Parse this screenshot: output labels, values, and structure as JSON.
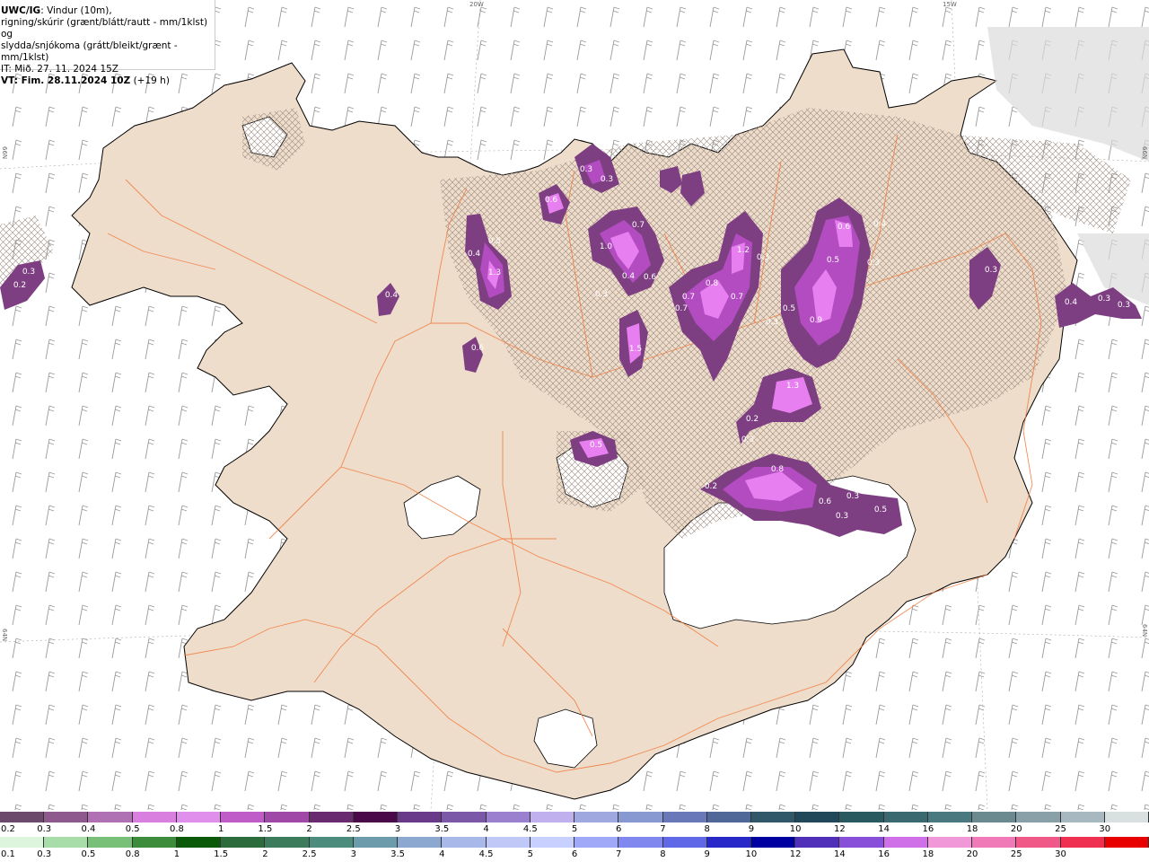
{
  "info": {
    "line1_bold": "UWC/IG",
    "line1_rest": ": Vindur (10m),",
    "line2": "rigning/skúrir (grænt/blátt/rautt - mm/1klst) og",
    "line3": "slydda/snjókoma (grátt/bleikt/grænt - mm/1klst)",
    "line4": "IT: Mið. 27. 11. 2024 15Z",
    "line5_bold": "VT: Fim. 28.11.2024 10Z",
    "line5_rest": " (+19 h)"
  },
  "coords": {
    "top_20w": "20W",
    "top_15w": "15W",
    "left_66n": "66N",
    "right_66n": "66N",
    "left_64n": "64N",
    "right_64n": "64N"
  },
  "colors": {
    "sea": "#ffffff",
    "land": "#efddcb",
    "roads": "#f07a3c",
    "precip_dark": "#7e3f82",
    "precip_mid": "#b24cc0",
    "precip_light": "#e87ff0"
  },
  "precip_labels": [
    {
      "text": "0.3"
    },
    {
      "text": "0.2"
    },
    {
      "text": "0.6"
    },
    {
      "text": "0.3"
    },
    {
      "text": "0.3"
    },
    {
      "text": "0.5"
    },
    {
      "text": "0.4"
    },
    {
      "text": "1.3"
    },
    {
      "text": "1.0"
    },
    {
      "text": "0.7"
    },
    {
      "text": "0.4"
    },
    {
      "text": "0.6"
    },
    {
      "text": "0.3"
    },
    {
      "text": "1.5"
    },
    {
      "text": "0.7"
    },
    {
      "text": "0.8"
    },
    {
      "text": "0.7"
    },
    {
      "text": "0.7"
    },
    {
      "text": "1.2"
    },
    {
      "text": "0.3"
    },
    {
      "text": "0.6"
    },
    {
      "text": "0.4"
    },
    {
      "text": "0.5"
    },
    {
      "text": "0.3"
    },
    {
      "text": "0.5"
    },
    {
      "text": "0.9"
    },
    {
      "text": "0.3"
    },
    {
      "text": "1.3"
    },
    {
      "text": "0.2"
    },
    {
      "text": "0.3"
    },
    {
      "text": "0.5"
    },
    {
      "text": "0.8"
    },
    {
      "text": "0.2"
    },
    {
      "text": "0.6"
    },
    {
      "text": "0.3"
    },
    {
      "text": "0.3"
    },
    {
      "text": "0.5"
    },
    {
      "text": "0.4"
    },
    {
      "text": "0.3"
    },
    {
      "text": "0.3"
    },
    {
      "text": "0.4"
    },
    {
      "text": "0.6"
    },
    {
      "text": "0.3"
    }
  ],
  "legend": {
    "row1_labels": [
      "0.2",
      "0.3",
      "0.4",
      "0.5",
      "0.8",
      "1",
      "1.5",
      "2",
      "2.5",
      "3",
      "3.5",
      "4",
      "4.5",
      "5",
      "6",
      "7",
      "8",
      "9",
      "10",
      "12",
      "14",
      "16",
      "18",
      "20",
      "25",
      "30"
    ],
    "row1_colors": [
      "#6b4a6b",
      "#8e5a8e",
      "#b070b4",
      "#d87fe0",
      "#e090ec",
      "#c05cc8",
      "#a048a8",
      "#6a2a70",
      "#4a0a4a",
      "#6a3a8a",
      "#7c58a8",
      "#9c80d0",
      "#c0b0ee",
      "#a0a8e0",
      "#8898d0",
      "#6878b8",
      "#506898",
      "#305868",
      "#204858",
      "#285a60",
      "#3a6a70",
      "#4a7a80",
      "#6a8a90",
      "#8aa0a8",
      "#a8b8c0",
      "#d8e0e0"
    ],
    "row2_labels": [
      "0.1",
      "0.3",
      "0.5",
      "0.8",
      "1",
      "1.5",
      "2",
      "2.5",
      "3",
      "3.5",
      "4",
      "4.5",
      "5",
      "6",
      "7",
      "8",
      "9",
      "10",
      "12",
      "14",
      "16",
      "18",
      "20",
      "25",
      "30"
    ],
    "row2_colors": [
      "#ddf5dd",
      "#a8dca8",
      "#78c078",
      "#3c8c3c",
      "#0a5a0a",
      "#2c6c3c",
      "#3c7c5c",
      "#4c8c7c",
      "#6c9cac",
      "#8ca8d0",
      "#a8b8e8",
      "#c0c8f8",
      "#c8d0ff",
      "#a0a8f8",
      "#8088f0",
      "#6068e8",
      "#2828c8",
      "#0000a0",
      "#5030b8",
      "#8850d8",
      "#d070e8",
      "#f098d8",
      "#f07ab8",
      "#f05888",
      "#f03050",
      "#e80000"
    ]
  }
}
